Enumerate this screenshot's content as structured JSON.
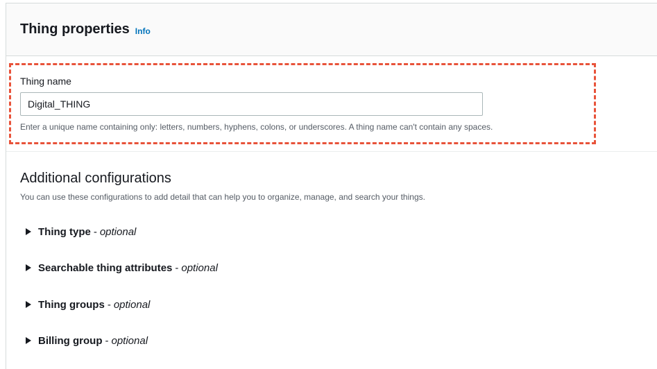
{
  "header": {
    "title": "Thing properties",
    "info_label": "Info"
  },
  "thing_name": {
    "label": "Thing name",
    "value": "Digital_THING",
    "hint": "Enter a unique name containing only: letters, numbers, hyphens, colons, or underscores. A thing name can't contain any spaces.",
    "highlight_color": "#e8533a"
  },
  "additional": {
    "title": "Additional configurations",
    "description": "You can use these configurations to add detail that can help you to organize, manage, and search your things.",
    "sections": [
      {
        "name": "Thing type",
        "separator": "-",
        "optional": "optional"
      },
      {
        "name": "Searchable thing attributes",
        "separator": "-",
        "optional": "optional"
      },
      {
        "name": "Thing groups",
        "separator": "-",
        "optional": "optional"
      },
      {
        "name": "Billing group",
        "separator": "-",
        "optional": "optional"
      }
    ]
  },
  "colors": {
    "link": "#0073bb",
    "text": "#16191f",
    "muted": "#545b64"
  }
}
